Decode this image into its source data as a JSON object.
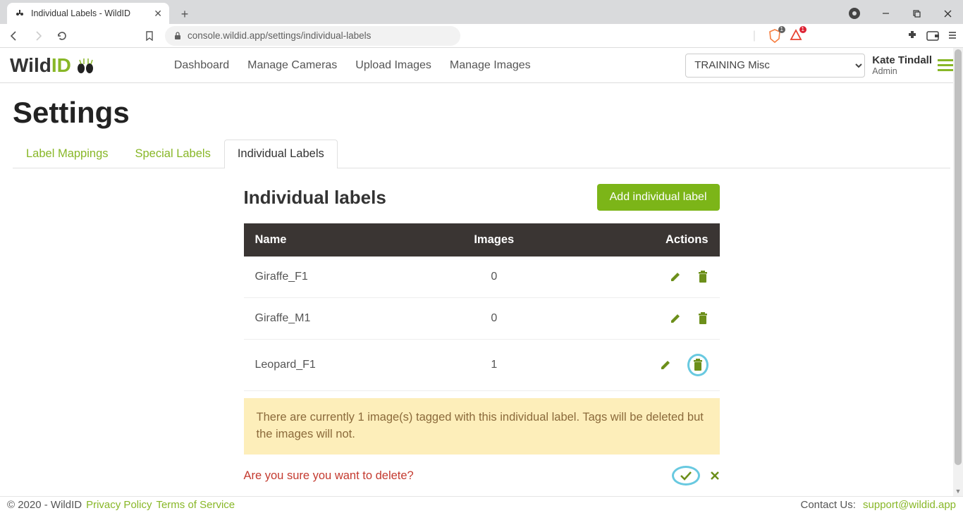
{
  "browser": {
    "tab_title": "Individual Labels - WildID",
    "url": "console.wildid.app/settings/individual-labels",
    "brave_badge": "1",
    "brave_ad_badge": "1"
  },
  "app_nav": {
    "logo_a": "Wild",
    "logo_b": "ID",
    "links": [
      "Dashboard",
      "Manage Cameras",
      "Upload Images",
      "Manage Images"
    ],
    "project": "TRAINING Misc",
    "user_name": "Kate Tindall",
    "user_role": "Admin"
  },
  "page": {
    "title": "Settings",
    "tabs": [
      "Label Mappings",
      "Special Labels",
      "Individual Labels"
    ],
    "active_tab": 2,
    "section_title": "Individual labels",
    "add_button": "Add individual label",
    "columns": [
      "Name",
      "Images",
      "Actions"
    ],
    "rows": [
      {
        "name": "Giraffe_F1",
        "images": "0"
      },
      {
        "name": "Giraffe_M1",
        "images": "0"
      },
      {
        "name": "Leopard_F1",
        "images": "1"
      }
    ],
    "warning": "There are currently 1 image(s) tagged with this individual label. Tags will be deleted but the images will not.",
    "confirm": "Are you sure you want to delete?"
  },
  "footer": {
    "copyright": "© 2020 - WildID",
    "privacy": "Privacy Policy",
    "terms": "Terms of Service",
    "contact_label": "Contact Us: ",
    "contact_email": "support@wildid.app"
  }
}
